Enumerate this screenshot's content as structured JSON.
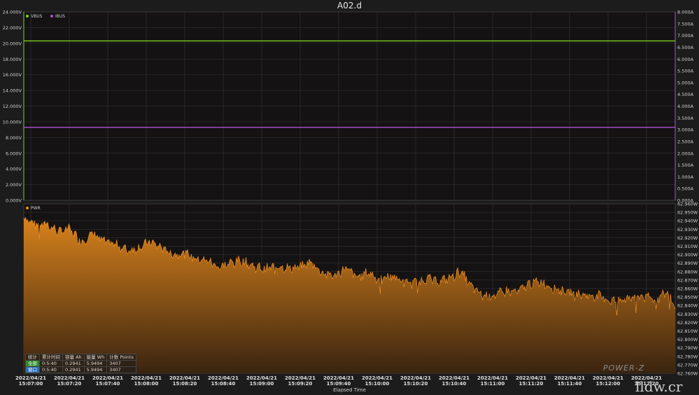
{
  "window": {
    "title": "A02.d"
  },
  "colors": {
    "vbus": "#7ed321",
    "ibus": "#b04fd8",
    "pwr": "#f0901e",
    "grid": "#3a3a3a"
  },
  "chart_data": [
    {
      "type": "line",
      "title": "A02.d",
      "legend": [
        "VBUS",
        "IBUS"
      ],
      "legend_position": "top-left",
      "grid": true,
      "y_left": {
        "unit": "V",
        "range": [
          0,
          24
        ],
        "ticks": [
          "24.000V",
          "22.000V",
          "20.000V",
          "18.000V",
          "16.000V",
          "14.000V",
          "12.000V",
          "10.000V",
          "8.000V",
          "6.000V",
          "4.000V",
          "2.000V",
          "0.000V"
        ]
      },
      "y_right": {
        "unit": "A",
        "range": [
          0,
          8
        ],
        "ticks": [
          "8.000A",
          "7.500A",
          "7.000A",
          "6.500A",
          "6.000A",
          "5.500A",
          "5.000A",
          "4.500A",
          "4.000A",
          "3.500A",
          "3.000A",
          "2.500A",
          "2.000A",
          "1.500A",
          "1.000A",
          "0.500A",
          "0.000A"
        ]
      },
      "series": [
        {
          "name": "VBUS",
          "axis": "left",
          "constant": 20.3
        },
        {
          "name": "IBUS",
          "axis": "right",
          "constant": 3.1
        }
      ]
    },
    {
      "type": "area",
      "legend": [
        "PWR"
      ],
      "legend_position": "top-left",
      "grid": true,
      "y_right": {
        "unit": "W",
        "range": [
          62.76,
          62.96
        ],
        "ticks": [
          "62.960W",
          "62.950W",
          "62.940W",
          "62.930W",
          "62.920W",
          "62.910W",
          "62.900W",
          "62.890W",
          "62.880W",
          "62.870W",
          "62.860W",
          "62.850W",
          "62.840W",
          "62.830W",
          "62.820W",
          "62.810W",
          "62.800W",
          "62.790W",
          "62.780W",
          "62.770W",
          "62.760W"
        ]
      },
      "x_range_seconds": [
        0,
        340
      ],
      "series": [
        {
          "name": "PWR",
          "t": [
            0,
            6,
            12,
            18,
            24,
            30,
            36,
            42,
            48,
            54,
            60,
            66,
            72,
            78,
            84,
            90,
            96,
            102,
            108,
            114,
            120,
            126,
            132,
            138,
            144,
            150,
            156,
            162,
            168,
            174,
            180,
            186,
            192,
            198,
            204,
            210,
            216,
            222,
            228,
            234,
            240,
            246,
            252,
            258,
            264,
            270,
            276,
            282,
            288,
            294,
            300,
            306,
            312,
            318,
            324,
            330,
            336,
            340
          ],
          "values": [
            62.944,
            62.935,
            62.936,
            62.927,
            62.93,
            62.915,
            62.925,
            62.915,
            62.912,
            62.905,
            62.908,
            62.915,
            62.908,
            62.9,
            62.902,
            62.895,
            62.893,
            62.885,
            62.89,
            62.893,
            62.886,
            62.883,
            62.887,
            62.884,
            62.885,
            62.891,
            62.878,
            62.875,
            62.884,
            62.873,
            62.879,
            62.87,
            62.875,
            62.868,
            62.866,
            62.872,
            62.868,
            62.872,
            62.88,
            62.861,
            62.851,
            62.852,
            62.857,
            62.856,
            62.866,
            62.868,
            62.861,
            62.857,
            62.853,
            62.852,
            62.851,
            62.846,
            62.845,
            62.852,
            62.85,
            62.848,
            62.855,
            62.838
          ]
        }
      ]
    }
  ],
  "x_axis": {
    "label": "Elapsed Time",
    "ticks": [
      {
        "date": "2022/04/21",
        "time": "15:07:00"
      },
      {
        "date": "2022/04/21",
        "time": "15:07:20"
      },
      {
        "date": "2022/04/21",
        "time": "15:07:40"
      },
      {
        "date": "2022/04/21",
        "time": "15:08:00"
      },
      {
        "date": "2022/04/21",
        "time": "15:08:20"
      },
      {
        "date": "2022/04/21",
        "time": "15:08:40"
      },
      {
        "date": "2022/04/21",
        "time": "15:09:00"
      },
      {
        "date": "2022/04/21",
        "time": "15:09:20"
      },
      {
        "date": "2022/04/21",
        "time": "15:09:40"
      },
      {
        "date": "2022/04/21",
        "time": "15:10:00"
      },
      {
        "date": "2022/04/21",
        "time": "15:10:20"
      },
      {
        "date": "2022/04/21",
        "time": "15:10:40"
      },
      {
        "date": "2022/04/21",
        "time": "15:11:00"
      },
      {
        "date": "2022/04/21",
        "time": "15:11:20"
      },
      {
        "date": "2022/04/21",
        "time": "15:11:40"
      },
      {
        "date": "2022/04/21",
        "time": "15:12:00"
      },
      {
        "date": "2022/04/21",
        "time": "15:12:20"
      }
    ]
  },
  "stats_table": {
    "header": [
      "统计",
      "累计时间",
      "容量 Ah",
      "能量 Wh",
      "计数 Points"
    ],
    "rows": [
      [
        "全部",
        "0:5:40",
        "0.2941",
        "5.9494",
        "3407"
      ],
      [
        "窗口",
        "0:5:40",
        "0.2941",
        "5.9494",
        "3407"
      ]
    ]
  },
  "brand": "POWER-Z",
  "watermark": "lldw.cr"
}
